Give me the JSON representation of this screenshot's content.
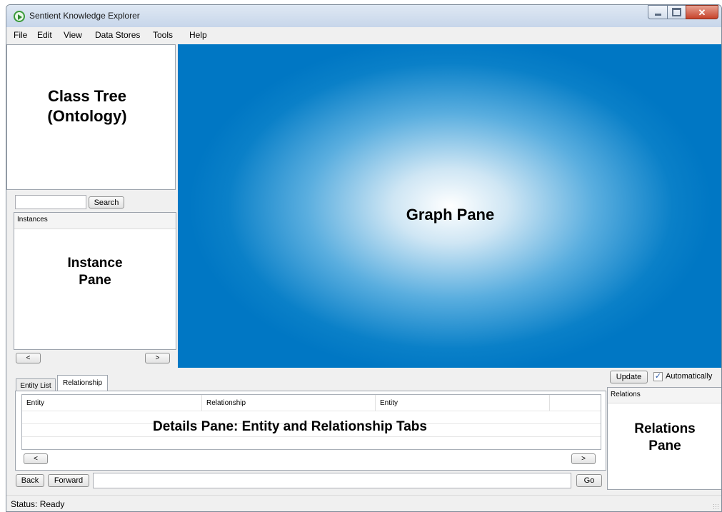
{
  "window": {
    "title": "Sentient Knowledge Explorer"
  },
  "menu": [
    {
      "label": "File"
    },
    {
      "label": "Edit"
    },
    {
      "label": "View"
    },
    {
      "label": "Data Stores"
    },
    {
      "label": "Tools"
    },
    {
      "label": "Help"
    }
  ],
  "class_tree": {
    "title_line1": "Class Tree",
    "title_line2": "(Ontology)"
  },
  "search": {
    "value": "",
    "button_label": "Search"
  },
  "instances": {
    "header": "Instances",
    "title_line1": "Instance",
    "title_line2": "Pane",
    "scroll_left": "<",
    "scroll_right": ">"
  },
  "graph": {
    "label": "Graph Pane"
  },
  "details": {
    "tabs": [
      {
        "label": "Entity List",
        "active": false
      },
      {
        "label": "Relationship",
        "active": true
      }
    ],
    "columns": [
      "Entity",
      "Relationship",
      "Entity"
    ],
    "overlay_label": "Details Pane: Entity and Relationship Tabs",
    "scroll_left": "<",
    "scroll_right": ">"
  },
  "navigation": {
    "back_label": "Back",
    "forward_label": "Forward",
    "address_value": "",
    "go_label": "Go"
  },
  "relations": {
    "update_label": "Update",
    "auto_checked": true,
    "auto_label": "Automatically",
    "header": "Relations",
    "title_line1": "Relations",
    "title_line2": "Pane"
  },
  "status": {
    "text": "Status:  Ready"
  },
  "colors": {
    "graph_center": "#ffffff",
    "graph_edge": "#0077c4",
    "close_button": "#c7432b"
  },
  "icons": [
    "app-logo-icon",
    "minimize-icon",
    "maximize-icon",
    "close-icon",
    "check-icon",
    "resize-grip-icon"
  ]
}
